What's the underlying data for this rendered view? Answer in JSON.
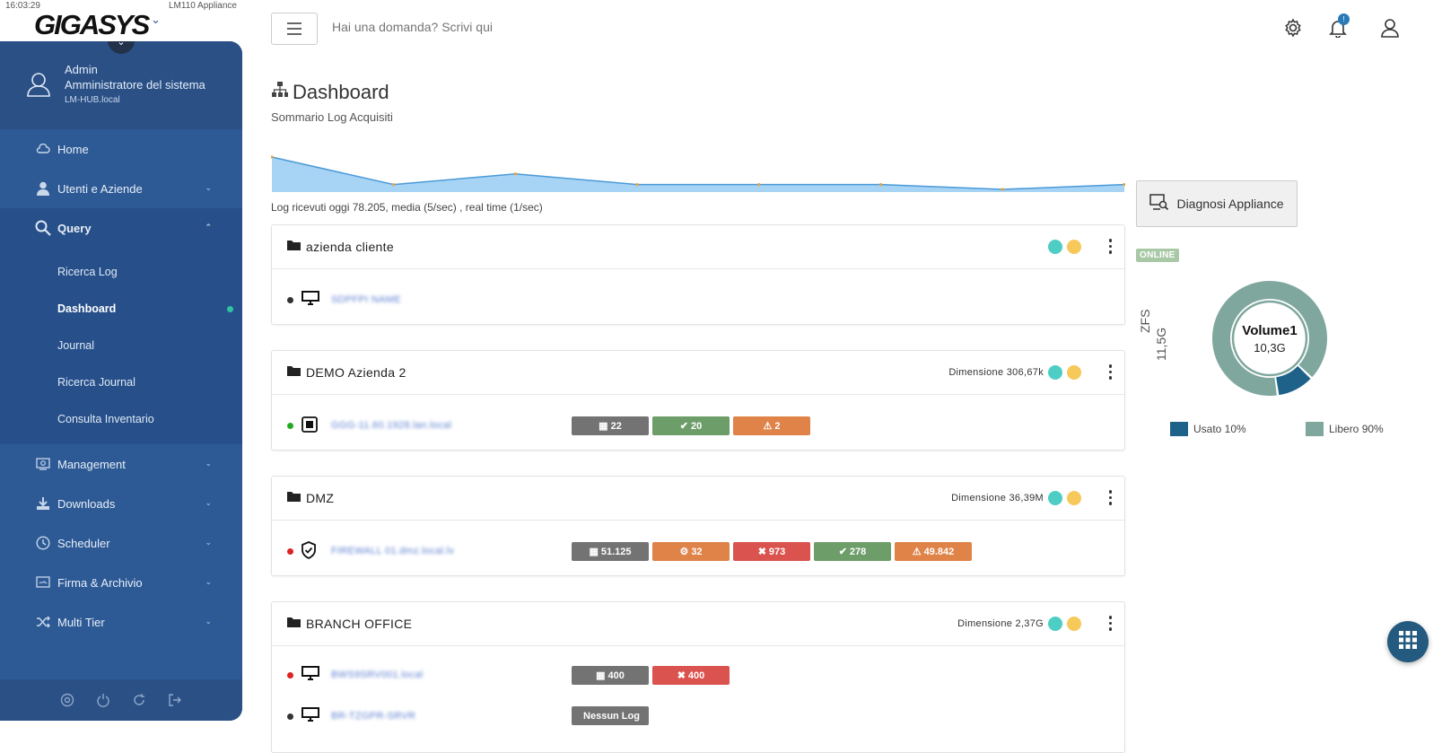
{
  "top": {
    "clock": "16:03:29",
    "appliance": "LM110 Appliance",
    "logo": "GIGASYS"
  },
  "user": {
    "name": "Admin",
    "role": "Amministratore del sistema",
    "host": "LM-HUB.local"
  },
  "nav": {
    "home": "Home",
    "utenti": "Utenti e Aziende",
    "query": "Query",
    "sub": [
      "Ricerca Log",
      "Dashboard",
      "Journal",
      "Ricerca Journal",
      "Consulta Inventario"
    ],
    "management": "Management",
    "downloads": "Downloads",
    "scheduler": "Scheduler",
    "firma": "Firma & Archivio",
    "multitier": "Multi Tier"
  },
  "header": {
    "search_placeholder": "Hai una domanda? Scrivi qui",
    "notif_badge": "!"
  },
  "page": {
    "title": "Dashboard",
    "subtitle": "Sommario Log Acquisiti",
    "logstats": "Log ricevuti oggi 78.205, media (5/sec) , real time (1/sec)"
  },
  "spark_values": [
    100,
    15,
    48,
    15,
    15,
    15,
    0,
    15
  ],
  "cards": [
    {
      "title": "azienda cliente",
      "size": "",
      "rows": [
        {
          "status": "#333333",
          "icon": "monitor-icon",
          "name": "SDPFPI NAME",
          "chips": []
        }
      ]
    },
    {
      "title": "DEMO Azienda 2",
      "size": "Dimensione 306,67k",
      "rows": [
        {
          "status": "#22aa22",
          "icon": "chip-icon",
          "name": "GGG-11.60.1928.lan.local",
          "chips": [
            {
              "type": "table",
              "color": "gray",
              "label": "22"
            },
            {
              "type": "check",
              "color": "green",
              "label": "20"
            },
            {
              "type": "warn",
              "color": "orange",
              "label": "2"
            }
          ]
        }
      ]
    },
    {
      "title": "DMZ",
      "size": "Dimensione 36,39M",
      "rows": [
        {
          "status": "#dd2222",
          "icon": "shield-icon",
          "name": "FIREWALL 01.dmz.local.lv",
          "chips": [
            {
              "type": "table",
              "color": "gray",
              "label": "51.125"
            },
            {
              "type": "gear",
              "color": "orange",
              "label": "32"
            },
            {
              "type": "x",
              "color": "red",
              "label": "973"
            },
            {
              "type": "check",
              "color": "green",
              "label": "278"
            },
            {
              "type": "warn",
              "color": "orange",
              "label": "49.842"
            }
          ]
        }
      ]
    },
    {
      "title": "BRANCH OFFICE",
      "size": "Dimensione 2,37G",
      "rows": [
        {
          "status": "#dd2222",
          "icon": "monitor-icon",
          "name": "BWS9SRV001.local",
          "chips": [
            {
              "type": "table",
              "color": "gray",
              "label": "400"
            },
            {
              "type": "x",
              "color": "red",
              "label": "400"
            }
          ]
        },
        {
          "status": "#333333",
          "icon": "monitor-icon",
          "name": "BR-TZGPR-SRVR",
          "chips": [
            {
              "type": "none",
              "color": "gray",
              "label": "Nessun Log"
            }
          ]
        }
      ]
    }
  ],
  "side": {
    "diag_label": "Diagnosi Appliance",
    "online": "ONLINE",
    "zfs": "ZFS",
    "zfs_size": "11,5G",
    "volume_name": "Volume1",
    "volume_size": "10,3G",
    "used_pct": 10,
    "legend_used": "Usato 10%",
    "legend_free": "Libero 90%"
  },
  "colors": {
    "sidebar": "#2d5a95",
    "used": "#1e6289",
    "free": "#7fa79d",
    "status_teal": "#4ecdc4",
    "status_yellow": "#f7c85a"
  }
}
